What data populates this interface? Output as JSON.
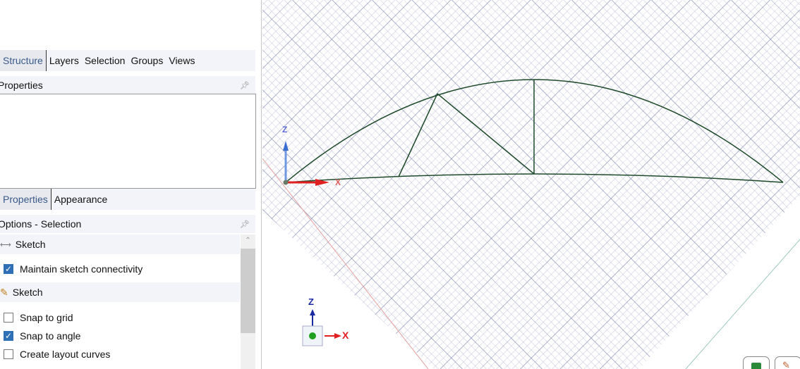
{
  "top_tabs": [
    "Structure",
    "Layers",
    "Selection",
    "Groups",
    "Views"
  ],
  "properties_title": "Properties",
  "prop_tabs": [
    "Properties",
    "Appearance"
  ],
  "options_title": "Options - Selection",
  "groups": [
    {
      "label": "Sketch",
      "options": [
        {
          "label": "Maintain sketch connectivity",
          "checked": true
        }
      ]
    },
    {
      "label": "Sketch",
      "options": [
        {
          "label": "Snap to grid",
          "checked": false
        },
        {
          "label": "Snap to angle",
          "checked": true
        },
        {
          "label": "Create layout curves",
          "checked": false
        }
      ]
    }
  ],
  "axes": {
    "z": "Z",
    "x": "X"
  },
  "colors": {
    "curve": "#1f4a2a",
    "x_axis": "#e02020",
    "z_axis": "#3a6fd0"
  }
}
